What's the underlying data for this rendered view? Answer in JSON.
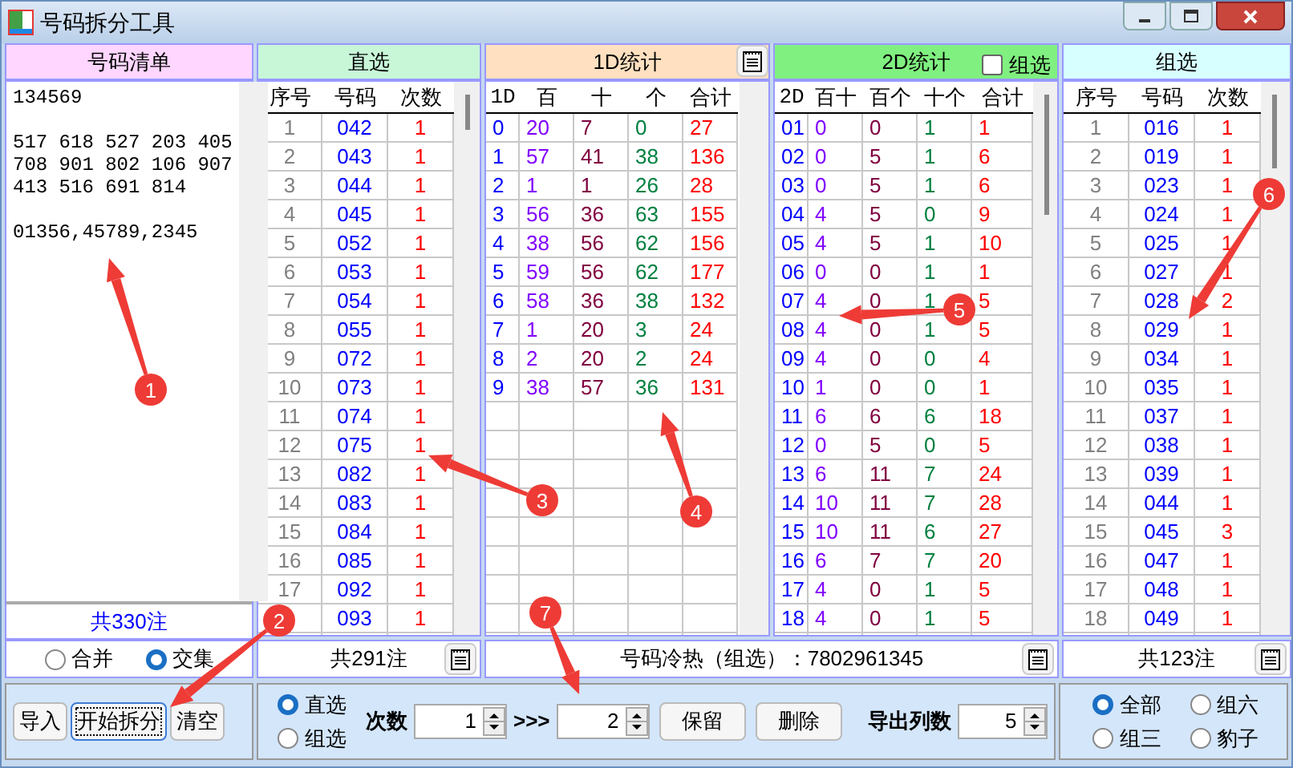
{
  "window": {
    "title": "号码拆分工具"
  },
  "number_list": {
    "title": "号码清单",
    "blocks": [
      [
        "134569"
      ],
      [
        "517 618 527 203 405",
        "708 901 802 106 907",
        "413 516 691 814"
      ],
      [
        "01356,45789,2345"
      ]
    ],
    "total": "共330注",
    "modes": [
      {
        "label": "合并",
        "selected": false
      },
      {
        "label": "交集",
        "selected": true
      }
    ]
  },
  "direct": {
    "title": "直选",
    "columns": [
      {
        "label": "序号",
        "color": "#808080"
      },
      {
        "label": "号码",
        "color": "#0000ff"
      },
      {
        "label": "次数",
        "color": "#ff0000"
      }
    ],
    "rows": [
      [
        "1",
        "042",
        "1"
      ],
      [
        "2",
        "043",
        "1"
      ],
      [
        "3",
        "044",
        "1"
      ],
      [
        "4",
        "045",
        "1"
      ],
      [
        "5",
        "052",
        "1"
      ],
      [
        "6",
        "053",
        "1"
      ],
      [
        "7",
        "054",
        "1"
      ],
      [
        "8",
        "055",
        "1"
      ],
      [
        "9",
        "072",
        "1"
      ],
      [
        "10",
        "073",
        "1"
      ],
      [
        "11",
        "074",
        "1"
      ],
      [
        "12",
        "075",
        "1"
      ],
      [
        "13",
        "082",
        "1"
      ],
      [
        "14",
        "083",
        "1"
      ],
      [
        "15",
        "084",
        "1"
      ],
      [
        "16",
        "085",
        "1"
      ],
      [
        "17",
        "092",
        "1"
      ],
      [
        null,
        "093",
        "1"
      ]
    ],
    "total": "共291注"
  },
  "stats_1d": {
    "title": "1D统计",
    "columns": [
      {
        "label": "1D",
        "color": "#0000ff"
      },
      {
        "label": "百",
        "color": "#8000ff"
      },
      {
        "label": "十",
        "color": "#800040"
      },
      {
        "label": "个",
        "color": "#008040"
      },
      {
        "label": "合计",
        "color": "#ff0000"
      }
    ],
    "rows": [
      [
        "0",
        "20",
        "7",
        "0",
        "27"
      ],
      [
        "1",
        "57",
        "41",
        "38",
        "136"
      ],
      [
        "2",
        "1",
        "1",
        "26",
        "28"
      ],
      [
        "3",
        "56",
        "36",
        "63",
        "155"
      ],
      [
        "4",
        "38",
        "56",
        "62",
        "156"
      ],
      [
        "5",
        "59",
        "56",
        "62",
        "177"
      ],
      [
        "6",
        "58",
        "36",
        "38",
        "132"
      ],
      [
        "7",
        "1",
        "20",
        "3",
        "24"
      ],
      [
        "8",
        "2",
        "20",
        "2",
        "24"
      ],
      [
        "9",
        "38",
        "57",
        "36",
        "131"
      ]
    ]
  },
  "stats_2d": {
    "title": "2D统计",
    "group_checkbox": {
      "label": "组选",
      "checked": false
    },
    "columns": [
      {
        "label": "2D",
        "color": "#0000ff"
      },
      {
        "label": "百十",
        "color": "#8000ff"
      },
      {
        "label": "百个",
        "color": "#800040"
      },
      {
        "label": "十个",
        "color": "#008040"
      },
      {
        "label": "合计",
        "color": "#ff0000"
      }
    ],
    "rows": [
      [
        "01",
        "0",
        "0",
        "1",
        "1"
      ],
      [
        "02",
        "0",
        "5",
        "1",
        "6"
      ],
      [
        "03",
        "0",
        "5",
        "1",
        "6"
      ],
      [
        "04",
        "4",
        "5",
        "0",
        "9"
      ],
      [
        "05",
        "4",
        "5",
        "1",
        "10"
      ],
      [
        "06",
        "0",
        "0",
        "1",
        "1"
      ],
      [
        "07",
        "4",
        "0",
        "1",
        "5"
      ],
      [
        "08",
        "4",
        "0",
        "1",
        "5"
      ],
      [
        "09",
        "4",
        "0",
        "0",
        "4"
      ],
      [
        "10",
        "1",
        "0",
        "0",
        "1"
      ],
      [
        "11",
        "6",
        "6",
        "6",
        "18"
      ],
      [
        "12",
        "0",
        "5",
        "0",
        "5"
      ],
      [
        "13",
        "6",
        "11",
        "7",
        "24"
      ],
      [
        "14",
        "10",
        "11",
        "7",
        "28"
      ],
      [
        "15",
        "10",
        "11",
        "6",
        "27"
      ],
      [
        "16",
        "6",
        "7",
        "7",
        "20"
      ],
      [
        "17",
        "4",
        "0",
        "1",
        "5"
      ],
      [
        "18",
        "4",
        "0",
        "1",
        "5"
      ]
    ]
  },
  "hot_cold": "号码冷热（组选）：7802961345",
  "group": {
    "title": "组选",
    "columns": [
      {
        "label": "序号",
        "color": "#808080"
      },
      {
        "label": "号码",
        "color": "#0000ff"
      },
      {
        "label": "次数",
        "color": "#ff0000"
      }
    ],
    "rows": [
      [
        "1",
        "016",
        "1"
      ],
      [
        "2",
        "019",
        "1"
      ],
      [
        "3",
        "023",
        "1"
      ],
      [
        "4",
        "024",
        "1"
      ],
      [
        "5",
        "025",
        "1"
      ],
      [
        "6",
        "027",
        "1"
      ],
      [
        "7",
        "028",
        "2"
      ],
      [
        "8",
        "029",
        "1"
      ],
      [
        "9",
        "034",
        "1"
      ],
      [
        "10",
        "035",
        "1"
      ],
      [
        "11",
        "037",
        "1"
      ],
      [
        "12",
        "038",
        "1"
      ],
      [
        "13",
        "039",
        "1"
      ],
      [
        "14",
        "044",
        "1"
      ],
      [
        "15",
        "045",
        "3"
      ],
      [
        "16",
        "047",
        "1"
      ],
      [
        "17",
        "048",
        "1"
      ],
      [
        "18",
        "049",
        "1"
      ]
    ],
    "total": "共123注"
  },
  "actions": [
    {
      "label": "导入",
      "focused": false
    },
    {
      "label": "开始拆分",
      "focused": true
    },
    {
      "label": "清空",
      "focused": false
    }
  ],
  "filter": {
    "types": [
      {
        "label": "直选",
        "selected": true
      },
      {
        "label": "组选",
        "selected": false
      }
    ],
    "count_label": "次数",
    "count_from": "1",
    "arrow": ">>>",
    "count_to": "2",
    "buttons": [
      "保留",
      "删除"
    ],
    "columns_label": "导出列数",
    "columns_value": "5"
  },
  "export_types": [
    {
      "label": "全部",
      "selected": true
    },
    {
      "label": "组六",
      "selected": false
    },
    {
      "label": "组三",
      "selected": false
    },
    {
      "label": "豹子",
      "selected": false
    }
  ],
  "callouts": [
    {
      "label": "1"
    },
    {
      "label": "2"
    },
    {
      "label": "3"
    },
    {
      "label": "4"
    },
    {
      "label": "5"
    },
    {
      "label": "6"
    },
    {
      "label": "7"
    }
  ]
}
